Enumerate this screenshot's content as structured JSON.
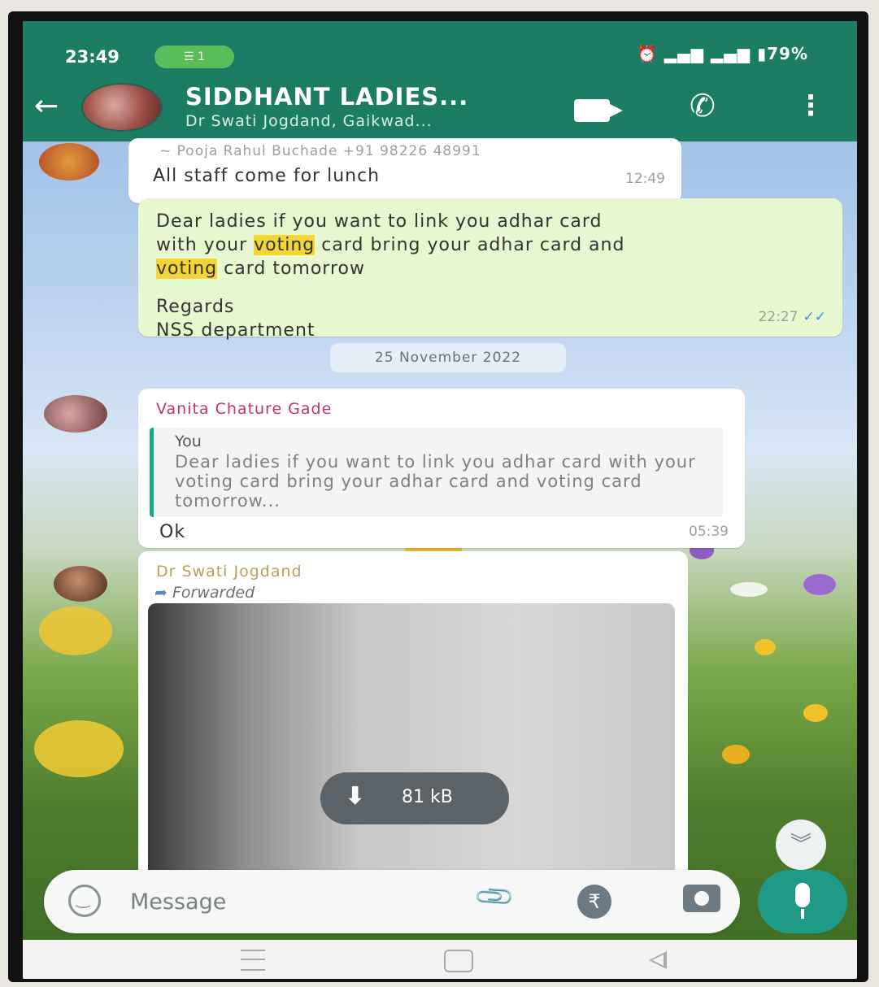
{
  "status_bar": {
    "time": "23:49",
    "sim_indicator": "1",
    "icons_text": "⏰ 📶 ▌▌.ıl ▌.ıl ▮79%",
    "battery": "79%"
  },
  "header": {
    "title": "SIDDHANT LADIES...",
    "subtitle": "Dr Swati Jogdand, Gaikwad...",
    "colors": {
      "bar": "#1d7c64"
    }
  },
  "messages": {
    "m1": {
      "forward_line": "~ Pooja Rahul Buchade  +91 98226 48991",
      "text": "All staff come for lunch",
      "time": "12:49"
    },
    "m2": {
      "line1": "Dear ladies if you want to link you adhar card",
      "line2_a": "with your ",
      "line2_hl": "voting",
      "line2_b": " card bring your adhar card and",
      "line3_hl": "voting",
      "line3_b": " card tomorrow",
      "signoff1": "Regards",
      "signoff2": "NSS department",
      "time": "22:27",
      "ticks": "✓✓"
    },
    "date_chip": "25 November 2022",
    "m3": {
      "sender": "Vanita Chature Gade",
      "quote_name": "You",
      "quote_text": "Dear ladies if you want to link you adhar card with your voting card bring your adhar card and voting card tomorrow...",
      "text": "Ok",
      "time": "05:39"
    },
    "m4": {
      "sender": "Dr  Swati Jogdand",
      "forwarded_label": "Forwarded",
      "download_size": "81 kB"
    }
  },
  "composer": {
    "placeholder": "Message"
  },
  "colors": {
    "outgoing_bubble": "#e7f7d0",
    "highlight": "#f3d533",
    "accent": "#1f9a86",
    "sender_name": "#c0365e"
  }
}
